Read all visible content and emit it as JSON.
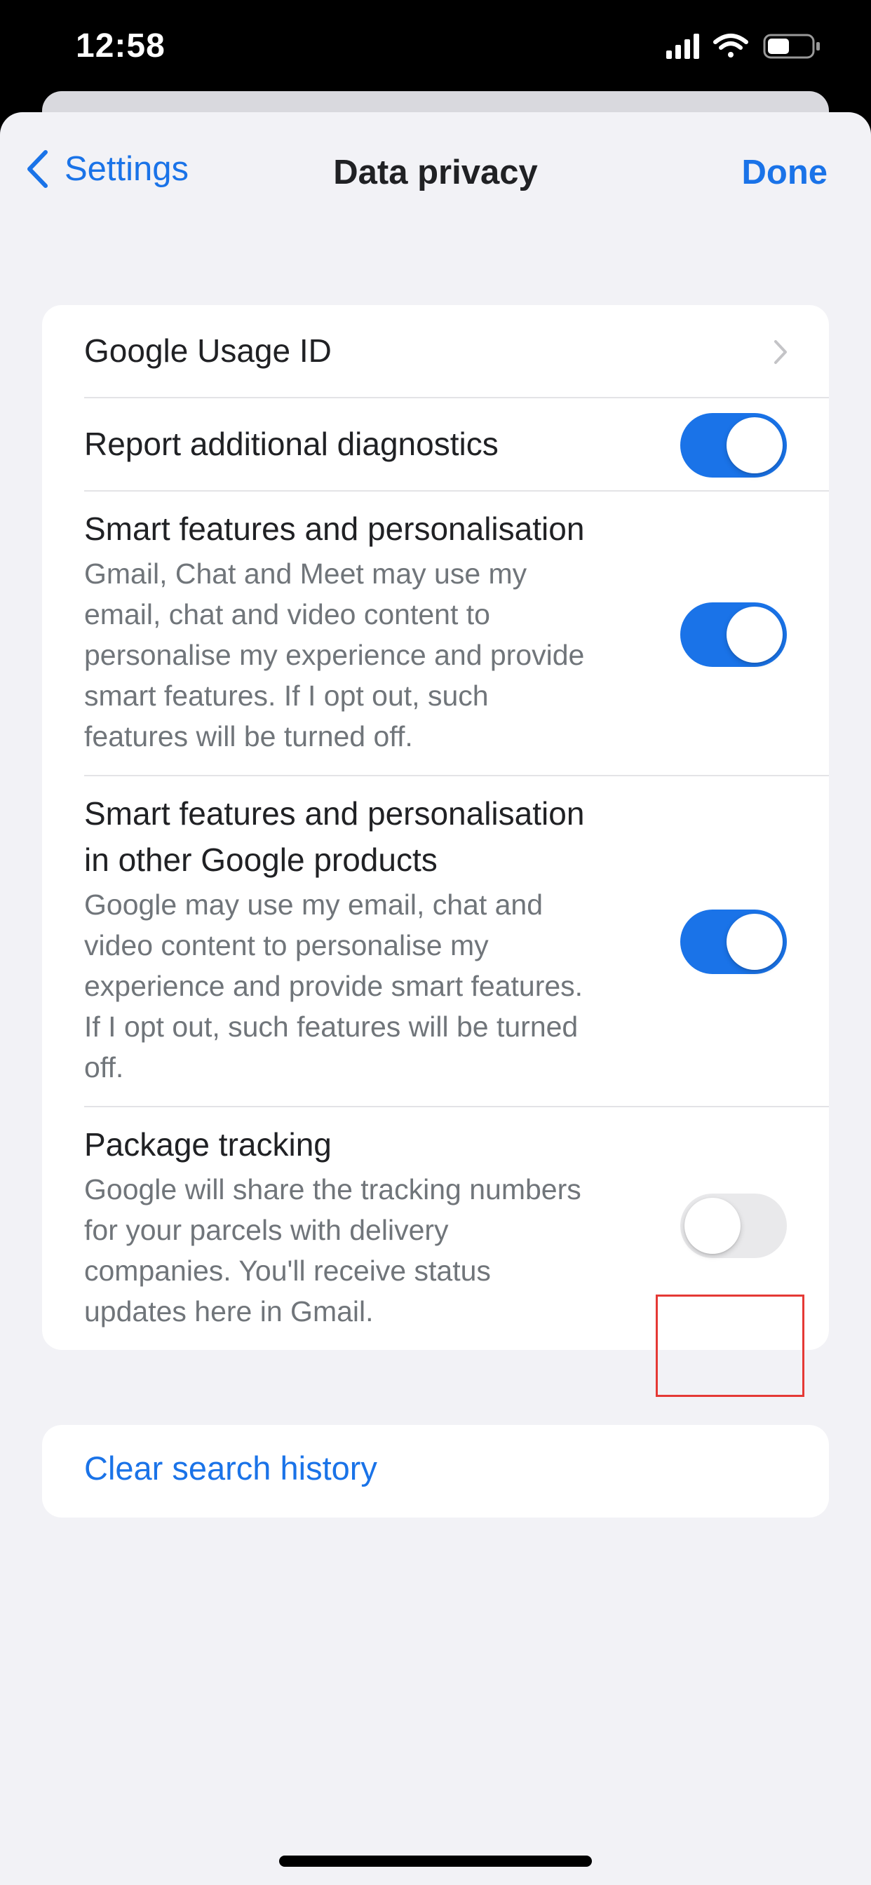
{
  "status_bar": {
    "time": "12:58"
  },
  "nav": {
    "back_label": "Settings",
    "title": "Data privacy",
    "done_label": "Done"
  },
  "rows": [
    {
      "title": "Google Usage ID",
      "control": "chevron"
    },
    {
      "title": "Report additional diagnostics",
      "control": "toggle",
      "on": true
    },
    {
      "title": "Smart features and personalisation",
      "description_lines": [
        "Gmail, Chat and Meet may use my",
        "email, chat and video content to",
        "personalise my experience and provide",
        "smart features. If I opt out, such",
        "features will be turned off."
      ],
      "control": "toggle",
      "on": true
    },
    {
      "title_lines": [
        "Smart features and personalisation",
        "in other Google products"
      ],
      "description_lines": [
        "Google may use my email, chat and",
        "video content to personalise my",
        "experience and provide smart features.",
        "If I opt out, such features will be turned",
        "off."
      ],
      "control": "toggle",
      "on": true
    },
    {
      "title": "Package tracking",
      "description_lines": [
        "Google will share the tracking numbers",
        "for your parcels with delivery",
        "companies. You'll receive status",
        "updates here in Gmail."
      ],
      "control": "toggle",
      "on": false
    }
  ],
  "clear_search": {
    "label": "Clear search history"
  },
  "colors": {
    "accent": "#1a73e8",
    "highlight": "#e53935"
  }
}
